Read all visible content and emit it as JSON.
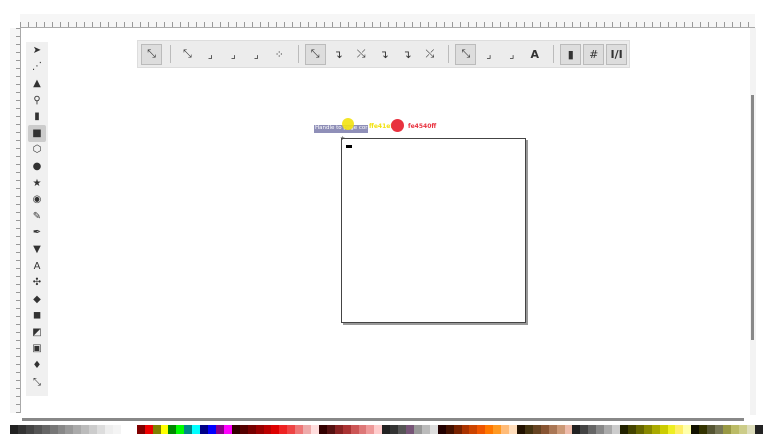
{
  "toolbox": {
    "tools": [
      "selector",
      "node",
      "tweak",
      "zoom",
      "measure",
      "rectangle",
      "3d-box",
      "ellipse",
      "star",
      "spiral",
      "pencil",
      "pen",
      "calligraphy",
      "text",
      "spray",
      "eraser",
      "bucket",
      "gradient",
      "mesh",
      "dropper",
      "connector"
    ],
    "active": "rectangle",
    "text_tool_glyph": "A"
  },
  "snap_toolbar": {
    "items": [
      "snap-toggle",
      "sep",
      "bbox",
      "bbox-edge",
      "bbox-corner",
      "bbox-midpoint",
      "bbox-center",
      "sep",
      "nodes",
      "path",
      "path-intersection",
      "cusp-nodes",
      "smooth-nodes",
      "line-midpoint",
      "sep",
      "others",
      "object-center",
      "rotation-center",
      "text-baseline",
      "sep",
      "page-border",
      "grid",
      "guides"
    ],
    "text_baseline_glyph": "A",
    "guides_glyph": "I/I"
  },
  "canvas": {
    "tooltip": "Handle to page corner",
    "yellow_label": "ffe41eff",
    "yellow_color": "#f2e20f",
    "red_label": "fe4540ff",
    "red_color": "#e8323f"
  },
  "palette": [
    "#222",
    "#333",
    "#444",
    "#555",
    "#666",
    "#777",
    "#888",
    "#999",
    "#aaa",
    "#bbb",
    "#ccc",
    "#ddd",
    "#eee",
    "#f4f4f4",
    "#fff",
    "#fff",
    "#800000",
    "#e00",
    "#808000",
    "#ff0",
    "#080",
    "#0f0",
    "#088",
    "#0ff",
    "#008",
    "#00f",
    "#808",
    "#f0f",
    "#300",
    "#500",
    "#700",
    "#900",
    "#b00",
    "#d00",
    "#e22",
    "#e44",
    "#e77",
    "#eaa",
    "#fdd",
    "#300",
    "#511",
    "#822",
    "#a33",
    "#c55",
    "#d77",
    "#e99",
    "#fcc",
    "#222",
    "#333",
    "#555",
    "#757",
    "#999",
    "#bbb",
    "#ddd",
    "#200",
    "#410",
    "#720",
    "#a30",
    "#c40",
    "#e50",
    "#f70",
    "#f92",
    "#fb7",
    "#fdb",
    "#210",
    "#431",
    "#642",
    "#853",
    "#a75",
    "#c97",
    "#eba",
    "#222",
    "#444",
    "#666",
    "#888",
    "#aaa",
    "#ccc",
    "#220",
    "#440",
    "#660",
    "#880",
    "#aa0",
    "#cc0",
    "#ee2",
    "#fe6",
    "#ffa",
    "#110",
    "#330",
    "#553",
    "#775",
    "#994",
    "#bb6",
    "#cc8",
    "#ddb",
    "#222"
  ]
}
